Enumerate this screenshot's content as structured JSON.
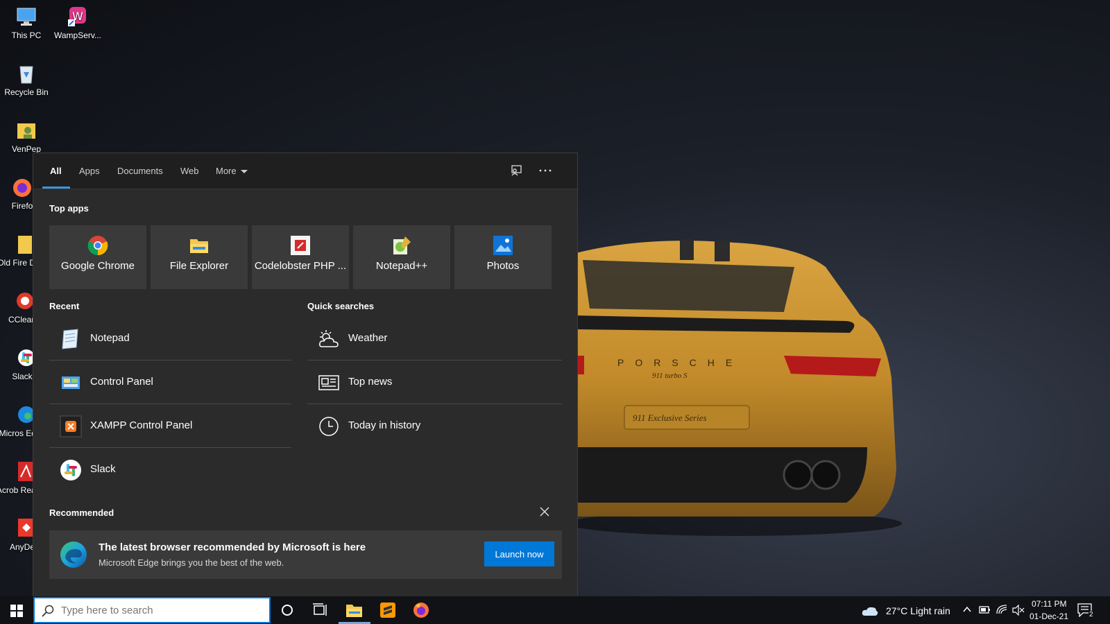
{
  "desktop": {
    "icons": [
      {
        "label": "This PC"
      },
      {
        "label": "WampServ..."
      },
      {
        "label": "Recycle Bin"
      },
      {
        "label": "VenPep"
      },
      {
        "label": "Firefo"
      },
      {
        "label": "Old Fire Data"
      },
      {
        "label": "CClean"
      },
      {
        "label": "Slack"
      },
      {
        "label": "Micros Edge"
      },
      {
        "label": "Acrob Reader"
      },
      {
        "label": "AnyDe"
      }
    ]
  },
  "search_panel": {
    "tabs": [
      {
        "label": "All",
        "active": true
      },
      {
        "label": "Apps"
      },
      {
        "label": "Documents"
      },
      {
        "label": "Web"
      },
      {
        "label": "More"
      }
    ],
    "top_apps_title": "Top apps",
    "top_apps": [
      {
        "label": "Google Chrome",
        "icon": "chrome-icon"
      },
      {
        "label": "File Explorer",
        "icon": "folder-icon"
      },
      {
        "label": "Codelobster PHP ...",
        "icon": "codelobster-icon"
      },
      {
        "label": "Notepad++",
        "icon": "notepadpp-icon"
      },
      {
        "label": "Photos",
        "icon": "photos-icon"
      }
    ],
    "recent_title": "Recent",
    "recent": [
      {
        "label": "Notepad",
        "icon": "notepad-icon"
      },
      {
        "label": "Control Panel",
        "icon": "control-panel-icon"
      },
      {
        "label": "XAMPP Control Panel",
        "icon": "xampp-icon"
      },
      {
        "label": "Slack",
        "icon": "slack-icon"
      }
    ],
    "quick_title": "Quick searches",
    "quick": [
      {
        "label": "Weather",
        "icon": "weather-icon"
      },
      {
        "label": "Top news",
        "icon": "news-icon"
      },
      {
        "label": "Today in history",
        "icon": "clock-icon"
      }
    ],
    "recommended_title": "Recommended",
    "recommended": {
      "title": "The latest browser recommended by Microsoft is here",
      "subtitle": "Microsoft Edge brings you the best of the web.",
      "button": "Launch now"
    }
  },
  "taskbar": {
    "search_placeholder": "Type here to search",
    "weather": "27°C  Light rain",
    "time": "07:11 PM",
    "date": "01-Dec-21",
    "notification_count": "2"
  },
  "colors": {
    "accent": "#0078d7",
    "panel_bg": "#2b2b2b",
    "tile_bg": "#3a3a3a",
    "tab_underline": "#3a96dd"
  }
}
